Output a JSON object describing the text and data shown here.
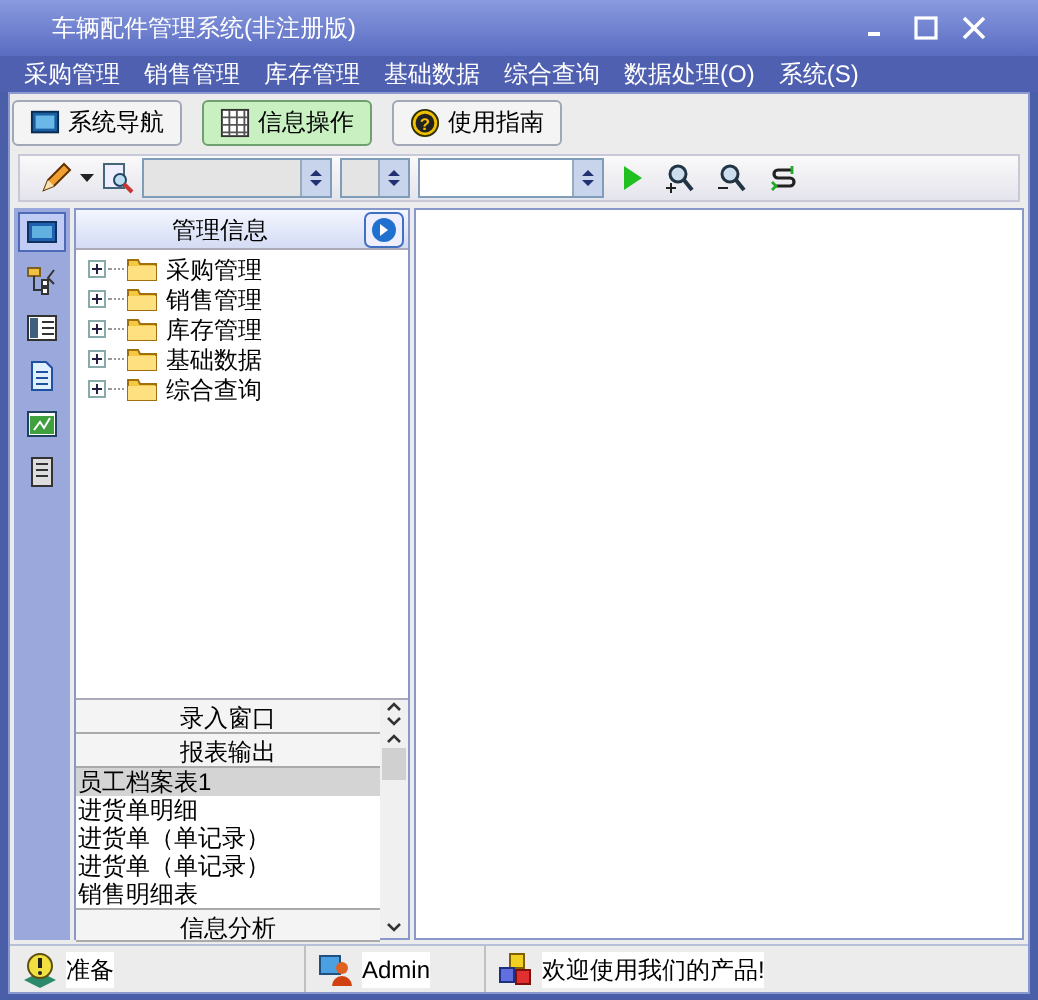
{
  "window": {
    "title": "车辆配件管理系统(非注册版)"
  },
  "menu": [
    "采购管理",
    "销售管理",
    "库存管理",
    "基础数据",
    "综合查询",
    "数据处理(O)",
    "系统(S)"
  ],
  "nav_buttons": [
    {
      "label": "系统导航",
      "selected": false
    },
    {
      "label": "信息操作",
      "selected": true
    },
    {
      "label": "使用指南",
      "selected": false,
      "icon_glyph": "?"
    }
  ],
  "side_tabs": [
    {
      "selected": true
    },
    {
      "selected": false
    },
    {
      "selected": false
    },
    {
      "selected": false
    },
    {
      "selected": false
    },
    {
      "selected": false
    }
  ],
  "tree": {
    "title": "管理信息",
    "items": [
      {
        "label": "采购管理",
        "expanded": false
      },
      {
        "label": "销售管理",
        "expanded": false
      },
      {
        "label": "库存管理",
        "expanded": false
      },
      {
        "label": "基础数据",
        "expanded": false
      },
      {
        "label": "综合查询",
        "expanded": false
      }
    ]
  },
  "bottom_panel": {
    "sections": [
      "录入窗口",
      "报表输出"
    ],
    "reports": [
      {
        "label": "员工档案表1",
        "selected": true
      },
      {
        "label": "进货单明细",
        "selected": false
      },
      {
        "label": "进货单（单记录）",
        "selected": false
      },
      {
        "label": "进货单（单记录）",
        "selected": false
      },
      {
        "label": "销售明细表",
        "selected": false
      }
    ],
    "footer": "信息分析"
  },
  "status_bar": {
    "status": "准备",
    "user": "Admin",
    "message": "欢迎使用我们的产品!"
  }
}
